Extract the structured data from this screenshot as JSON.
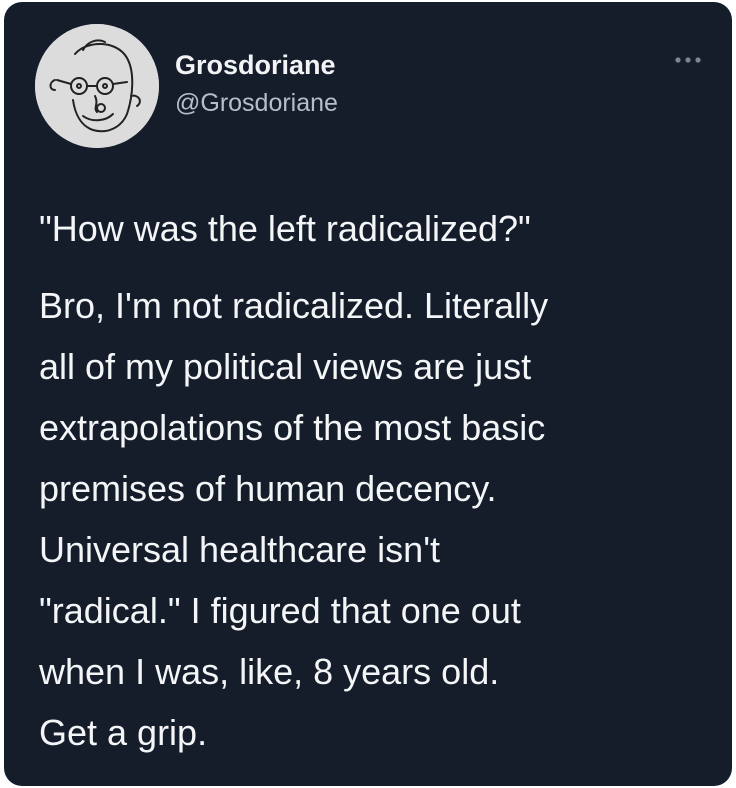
{
  "tweet": {
    "author": {
      "display_name": "Grosdoriane",
      "handle": "@Grosdoriane",
      "avatar_icon": "line-drawing-face-avatar"
    },
    "more_icon": "more-options-ellipsis-icon",
    "question": "\"How was the left radicalized?\"",
    "answer_lines": [
      "Bro, I'm not radicalized. Literally",
      "all of my political views are just",
      "extrapolations of the most basic",
      "premises of human decency.",
      "Universal healthcare isn't",
      "\"radical.\" I figured that one out",
      "when I was, like, 8 years old.",
      "Get a grip."
    ]
  },
  "theme": {
    "card_background": "#151d2b",
    "text_primary": "#f4f5f7",
    "text_secondary": "#b8bec7",
    "avatar_background": "#dcdcdc"
  }
}
